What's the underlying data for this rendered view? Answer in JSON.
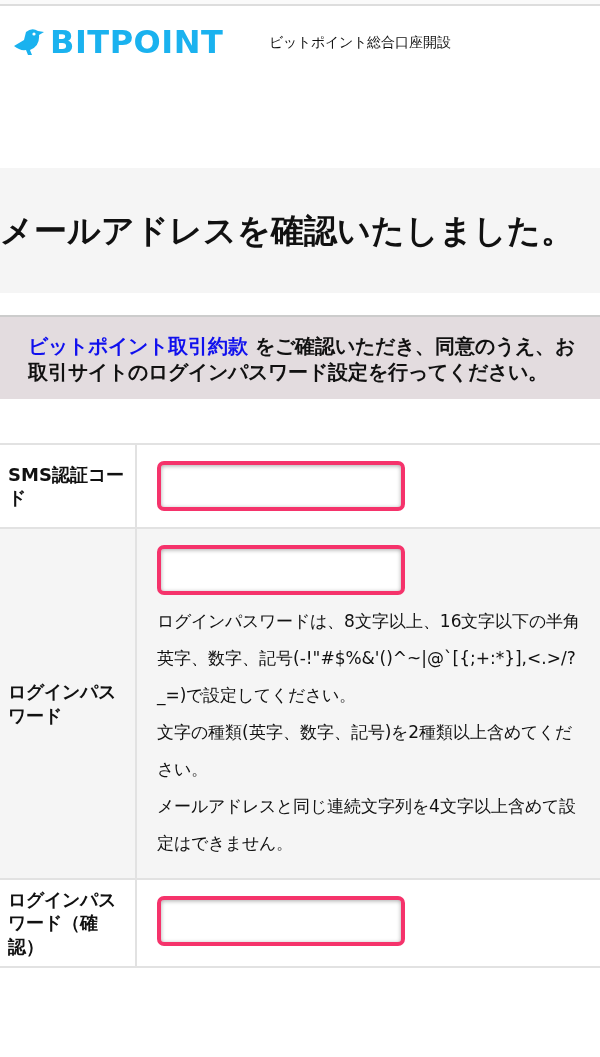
{
  "header": {
    "logo_text": "BITPOINT",
    "subtitle": "ビットポイント総合口座開設"
  },
  "heading": "メールアドレスを確認いたしました。",
  "notice": {
    "link": "ビットポイント取引約款",
    "text": " をご確認いただき、同意のうえ、お取引サイトのログインパスワード設定を行ってください。"
  },
  "form_rows": [
    {
      "label": "SMS認証コード"
    },
    {
      "label": "ログインパスワード",
      "notes": [
        "ログインパスワードは、8文字以上、16文字以下の半角英字、数字、記号(-!\"#$%&'()^~|@`[{;+:*}],<.>/?_=)で設定してください。",
        "文字の種類(英字、数字、記号)を2種類以上含めてください。",
        "メールアドレスと同じ連続文字列を4文字以上含めて設定はできません。"
      ]
    },
    {
      "label": "ログインパスワード（確認）"
    }
  ]
}
